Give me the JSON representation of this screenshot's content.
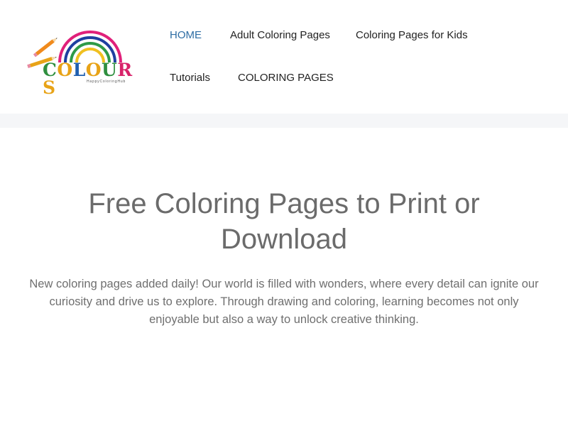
{
  "logo": {
    "wordmark": [
      "C",
      "O",
      "L",
      "O",
      "U",
      "R",
      "S"
    ],
    "wordmark_colors": [
      "#2f8f3f",
      "#e8a317",
      "#1f5fb0",
      "#e8a317",
      "#2f8f3f",
      "#d8236a",
      "#e8a317"
    ],
    "tagline": "HappyColoringHub",
    "rainbow_colors": [
      "#e0207a",
      "#1e3fa0",
      "#2e9a48",
      "#f0c020"
    ]
  },
  "nav": {
    "items": [
      {
        "label": "HOME",
        "active": true
      },
      {
        "label": "Adult Coloring Pages",
        "active": false
      },
      {
        "label": "Coloring Pages for Kids",
        "active": false
      },
      {
        "label": "Tutorials",
        "active": false
      },
      {
        "label": "COLORING PAGES",
        "active": false
      }
    ],
    "active_color": "#2e6da4"
  },
  "hero": {
    "title": "Free Coloring Pages to Print or Download",
    "description": "New coloring pages added daily! Our world is filled with wonders, where every detail can ignite our curiosity and drive us to explore. Through drawing and coloring, learning becomes not only enjoyable but also a way to unlock creative thinking."
  }
}
